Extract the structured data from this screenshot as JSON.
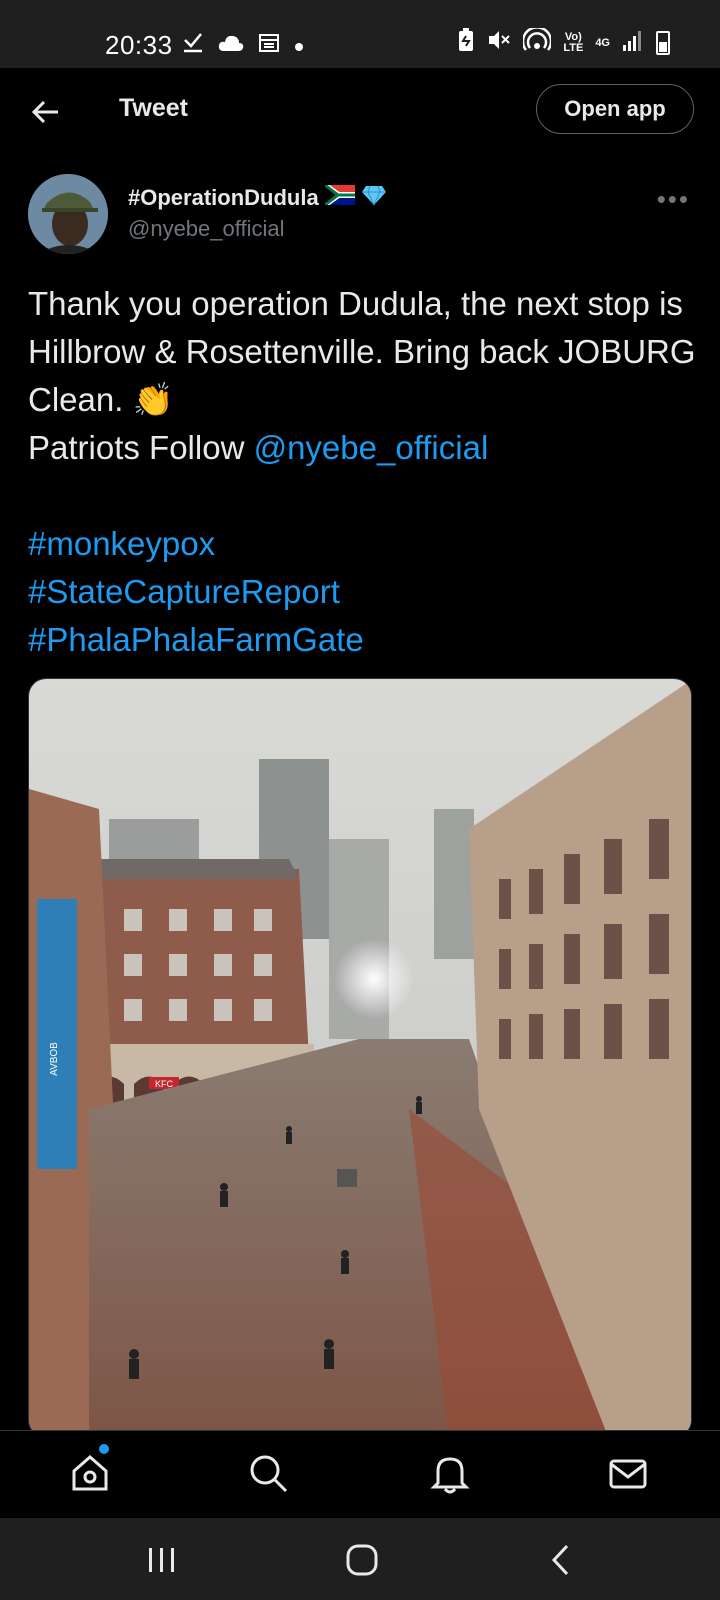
{
  "status_bar": {
    "time": "20:33",
    "lte_label": "Vo)\nLTE",
    "network_label": "4G"
  },
  "top_bar": {
    "title": "Tweet",
    "open_app_label": "Open app"
  },
  "tweet": {
    "display_name": "#OperationDudula",
    "handle": "@nyebe_official",
    "line1": "Thank you operation Dudula, the next stop is Hillbrow & Rosettenville. Bring back JOBURG Clean.",
    "emoji": "👏",
    "follow_prefix": "Patriots Follow ",
    "mention": "@nyebe_official",
    "hashtags": [
      "#monkeypox",
      "#StateCaptureReport",
      "#PhalaPhalaFarmGate"
    ]
  },
  "media": {
    "kfc_sign": "KFC",
    "aviator_sign": "AVBOB"
  },
  "colors": {
    "background": "#000000",
    "link": "#1d9bf0",
    "text": "#e7e9ea",
    "muted": "#71767b"
  },
  "icons": [
    "back-arrow-icon",
    "more-icon",
    "home-icon",
    "search-icon",
    "bell-icon",
    "mail-icon"
  ]
}
